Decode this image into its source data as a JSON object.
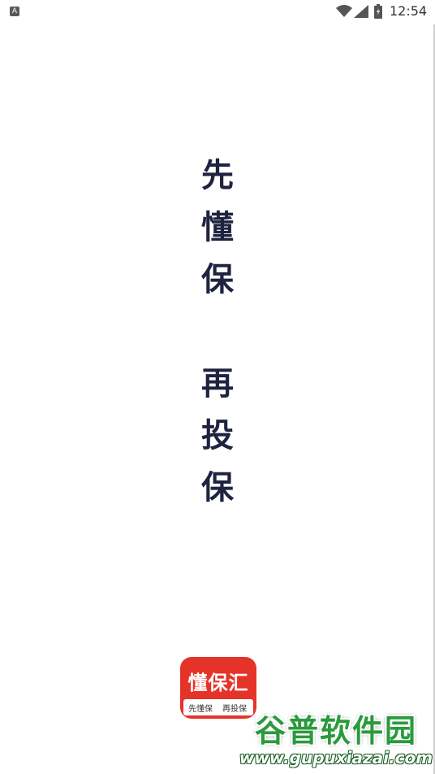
{
  "status_bar": {
    "notification_icon_label": "A",
    "time": "12:54",
    "icons": [
      "notification-icon",
      "wifi-icon",
      "signal-icon",
      "battery-icon"
    ]
  },
  "slogan": {
    "line1": [
      "先",
      "懂",
      "保"
    ],
    "line2": [
      "再",
      "投",
      "保"
    ]
  },
  "app_logo": {
    "name": "懂保汇",
    "tag1": "先懂保",
    "tag2": "再投保",
    "color": "#e5332a"
  },
  "watermark": {
    "title": "谷普软件园",
    "url": "www.gupuxiazai.com"
  },
  "colors": {
    "slogan_text": "#1f2340",
    "watermark_green": "#2a9a3c"
  }
}
